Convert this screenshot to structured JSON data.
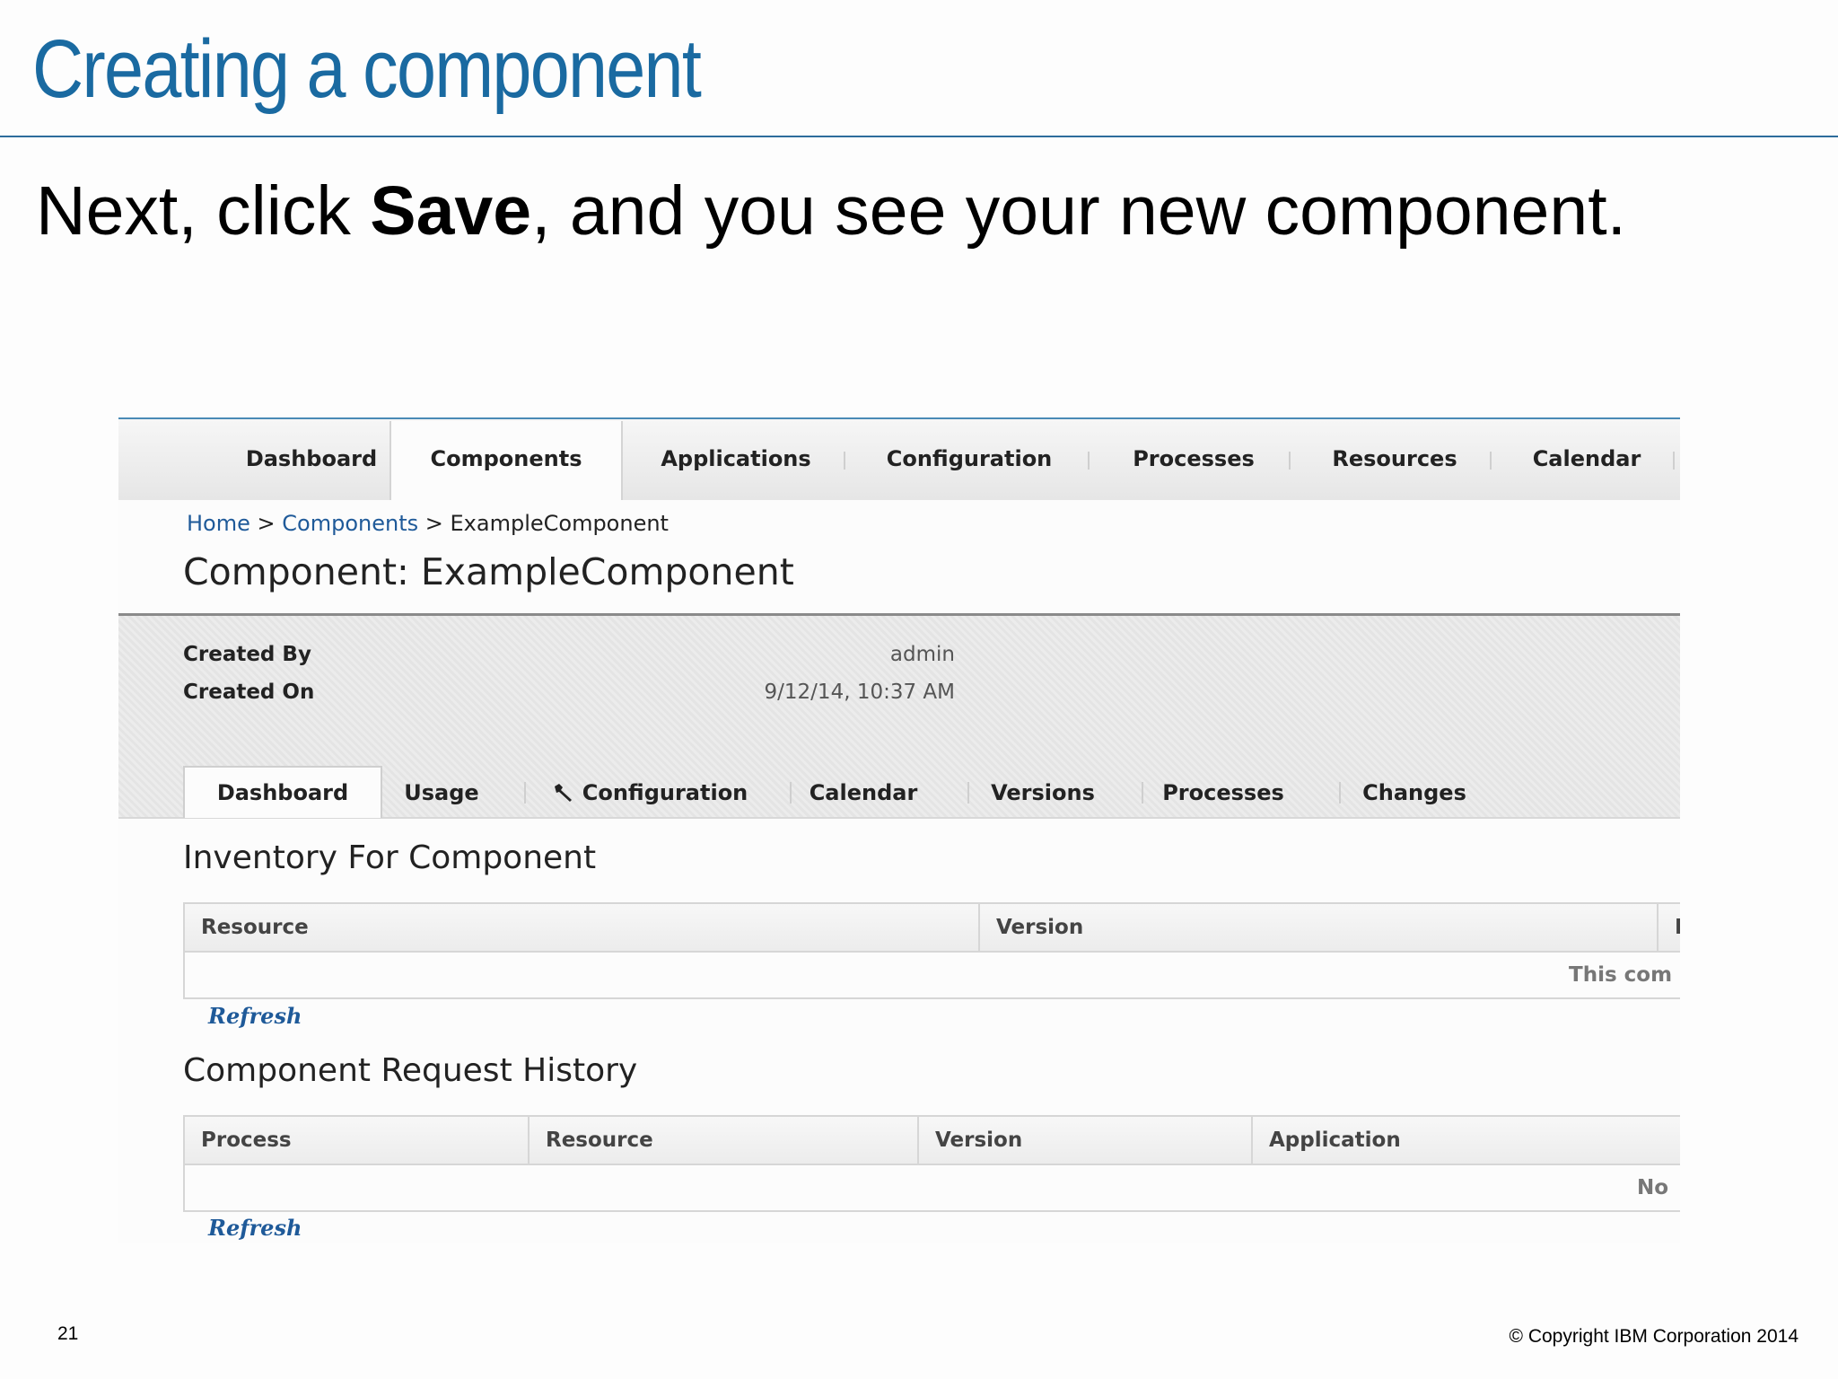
{
  "slide": {
    "title": "Creating a component",
    "subtitle_pre": "Next, click ",
    "subtitle_bold": "Save",
    "subtitle_post": ", and you see your new component.",
    "page_number": "21",
    "copyright": "© Copyright IBM Corporation 2014"
  },
  "topnav": {
    "tabs": [
      "Dashboard",
      "Components",
      "Applications",
      "Configuration",
      "Processes",
      "Resources",
      "Calendar"
    ],
    "active": "Components"
  },
  "breadcrumb": {
    "home": "Home",
    "sep1": ">",
    "components": "Components",
    "sep2": ">",
    "current": "ExampleComponent"
  },
  "component": {
    "title": "Component: ExampleComponent",
    "created_by_label": "Created By",
    "created_by_value": "admin",
    "created_on_label": "Created On",
    "created_on_value": "9/12/14, 10:37 AM"
  },
  "subtabs": {
    "items": [
      "Dashboard",
      "Usage",
      "Configuration",
      "Calendar",
      "Versions",
      "Processes",
      "Changes"
    ],
    "active": "Dashboard",
    "configuration_icon": "wrench-icon"
  },
  "inventory": {
    "heading": "Inventory For Component",
    "columns": [
      "Resource",
      "Version",
      "I"
    ],
    "empty_text": "This com",
    "refresh": "Refresh"
  },
  "history": {
    "heading": "Component Request History",
    "columns": [
      "Process",
      "Resource",
      "Version",
      "Application"
    ],
    "empty_text": "No",
    "refresh": "Refresh"
  },
  "colors": {
    "title_blue": "#1a6aa1",
    "link_blue": "#1f5a99",
    "rule_blue": "#2d6c9c"
  }
}
